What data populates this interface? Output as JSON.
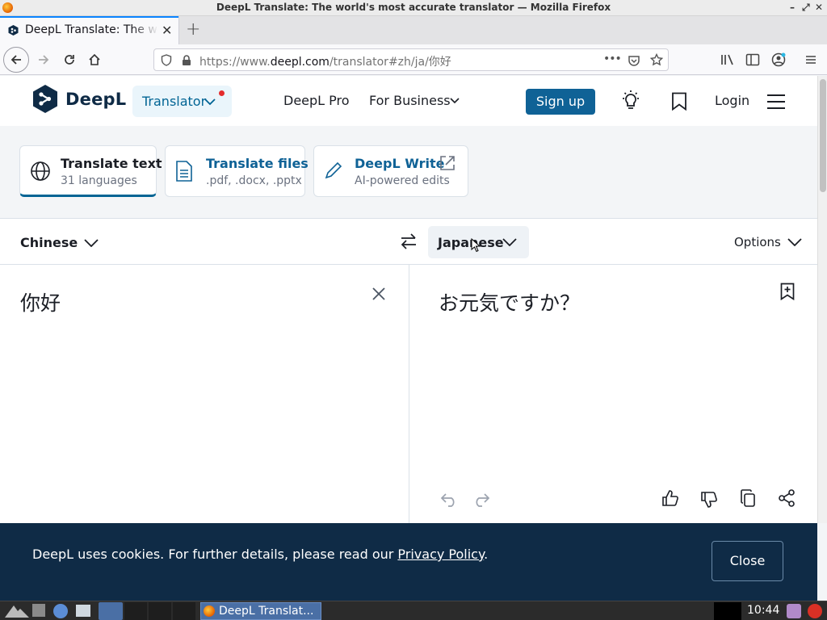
{
  "window": {
    "title": "DeepL Translate: The world's most accurate translator — Mozilla Firefox"
  },
  "browser": {
    "tab_title": "DeepL Translate: The world's most accurate translator",
    "url_prefix": "https://www.",
    "url_domain": "deepl.com",
    "url_path": "/translator#zh/ja/你好",
    "more_label": "•••"
  },
  "header": {
    "brand": "DeepL",
    "translator_label": "Translator",
    "pro_label": "DeepL Pro",
    "business_label": "For Business",
    "signup_label": "Sign up",
    "login_label": "Login"
  },
  "modes": [
    {
      "title": "Translate text",
      "subtitle": "31 languages"
    },
    {
      "title": "Translate files",
      "subtitle": ".pdf, .docx, .pptx"
    },
    {
      "title": "DeepL Write",
      "subtitle": "AI-powered edits"
    }
  ],
  "translator": {
    "source_lang": "Chinese",
    "target_lang": "Japanese",
    "options_label": "Options",
    "source_text": "你好",
    "target_text": "お元気ですか？"
  },
  "cookie": {
    "message": "DeepL uses cookies. For further details, please read our ",
    "link": "Privacy Policy",
    "period": ".",
    "close_label": "Close"
  },
  "taskbar": {
    "app_label": "DeepL Translat...",
    "clock": "10:44"
  },
  "colors": {
    "brand_navy": "#0f2b46",
    "accent_blue": "#0f6296",
    "notification_dot": "#e42b2b"
  }
}
